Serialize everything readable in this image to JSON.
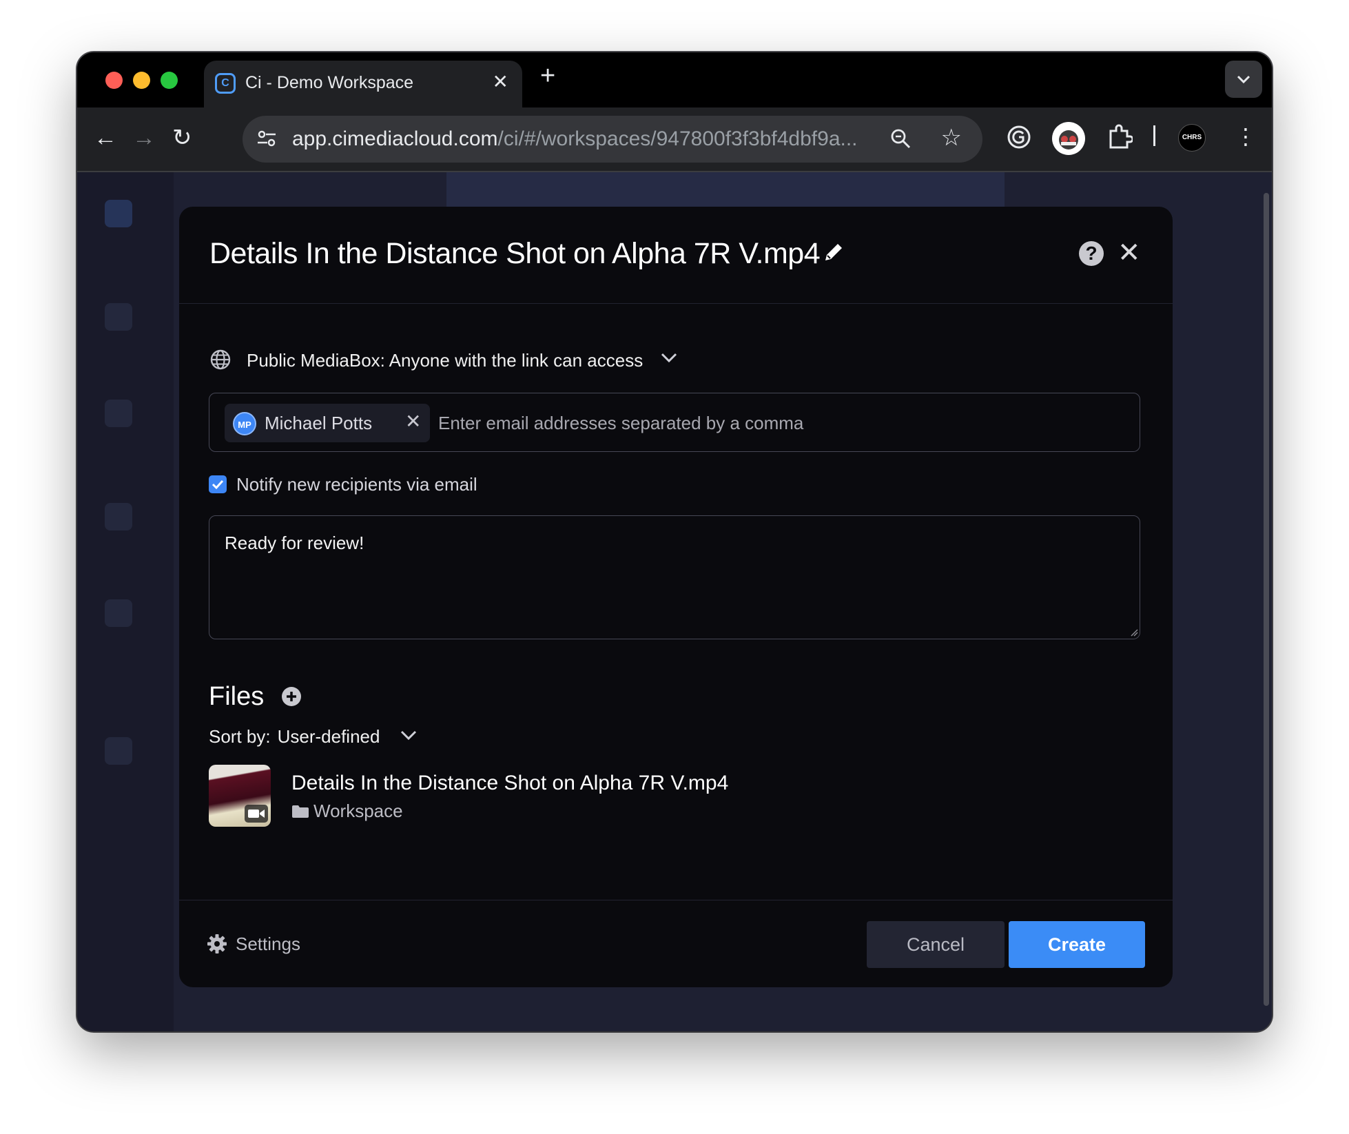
{
  "browser": {
    "tab_title": "Ci - Demo Workspace",
    "url_host": "app.cimediacloud.com",
    "url_path": "/ci/#/workspaces/947800f3f3bf4dbf9a...",
    "extension_badge": "CHRS"
  },
  "modal": {
    "title": "Details In the Distance Shot on Alpha 7R V.mp4",
    "help_label": "?",
    "close_label": "✕",
    "access_label": "Public MediaBox: Anyone with the link can access",
    "recipient": {
      "initials": "MP",
      "name": "Michael Potts",
      "remove_label": "✕"
    },
    "email_placeholder": "Enter email addresses separated by a comma",
    "notify_label": "Notify new recipients via email",
    "notify_checked": true,
    "message": "Ready for review!",
    "files_heading": "Files",
    "sort_label": "Sort by:",
    "sort_value": "User-defined",
    "files": [
      {
        "name": "Details In the Distance Shot on Alpha 7R V.mp4",
        "location": "Workspace"
      }
    ],
    "settings_label": "Settings",
    "cancel_label": "Cancel",
    "create_label": "Create"
  },
  "colors": {
    "accent": "#3b8cf6",
    "modal_bg": "#0a0a0e",
    "page_bg": "#1e2032"
  }
}
